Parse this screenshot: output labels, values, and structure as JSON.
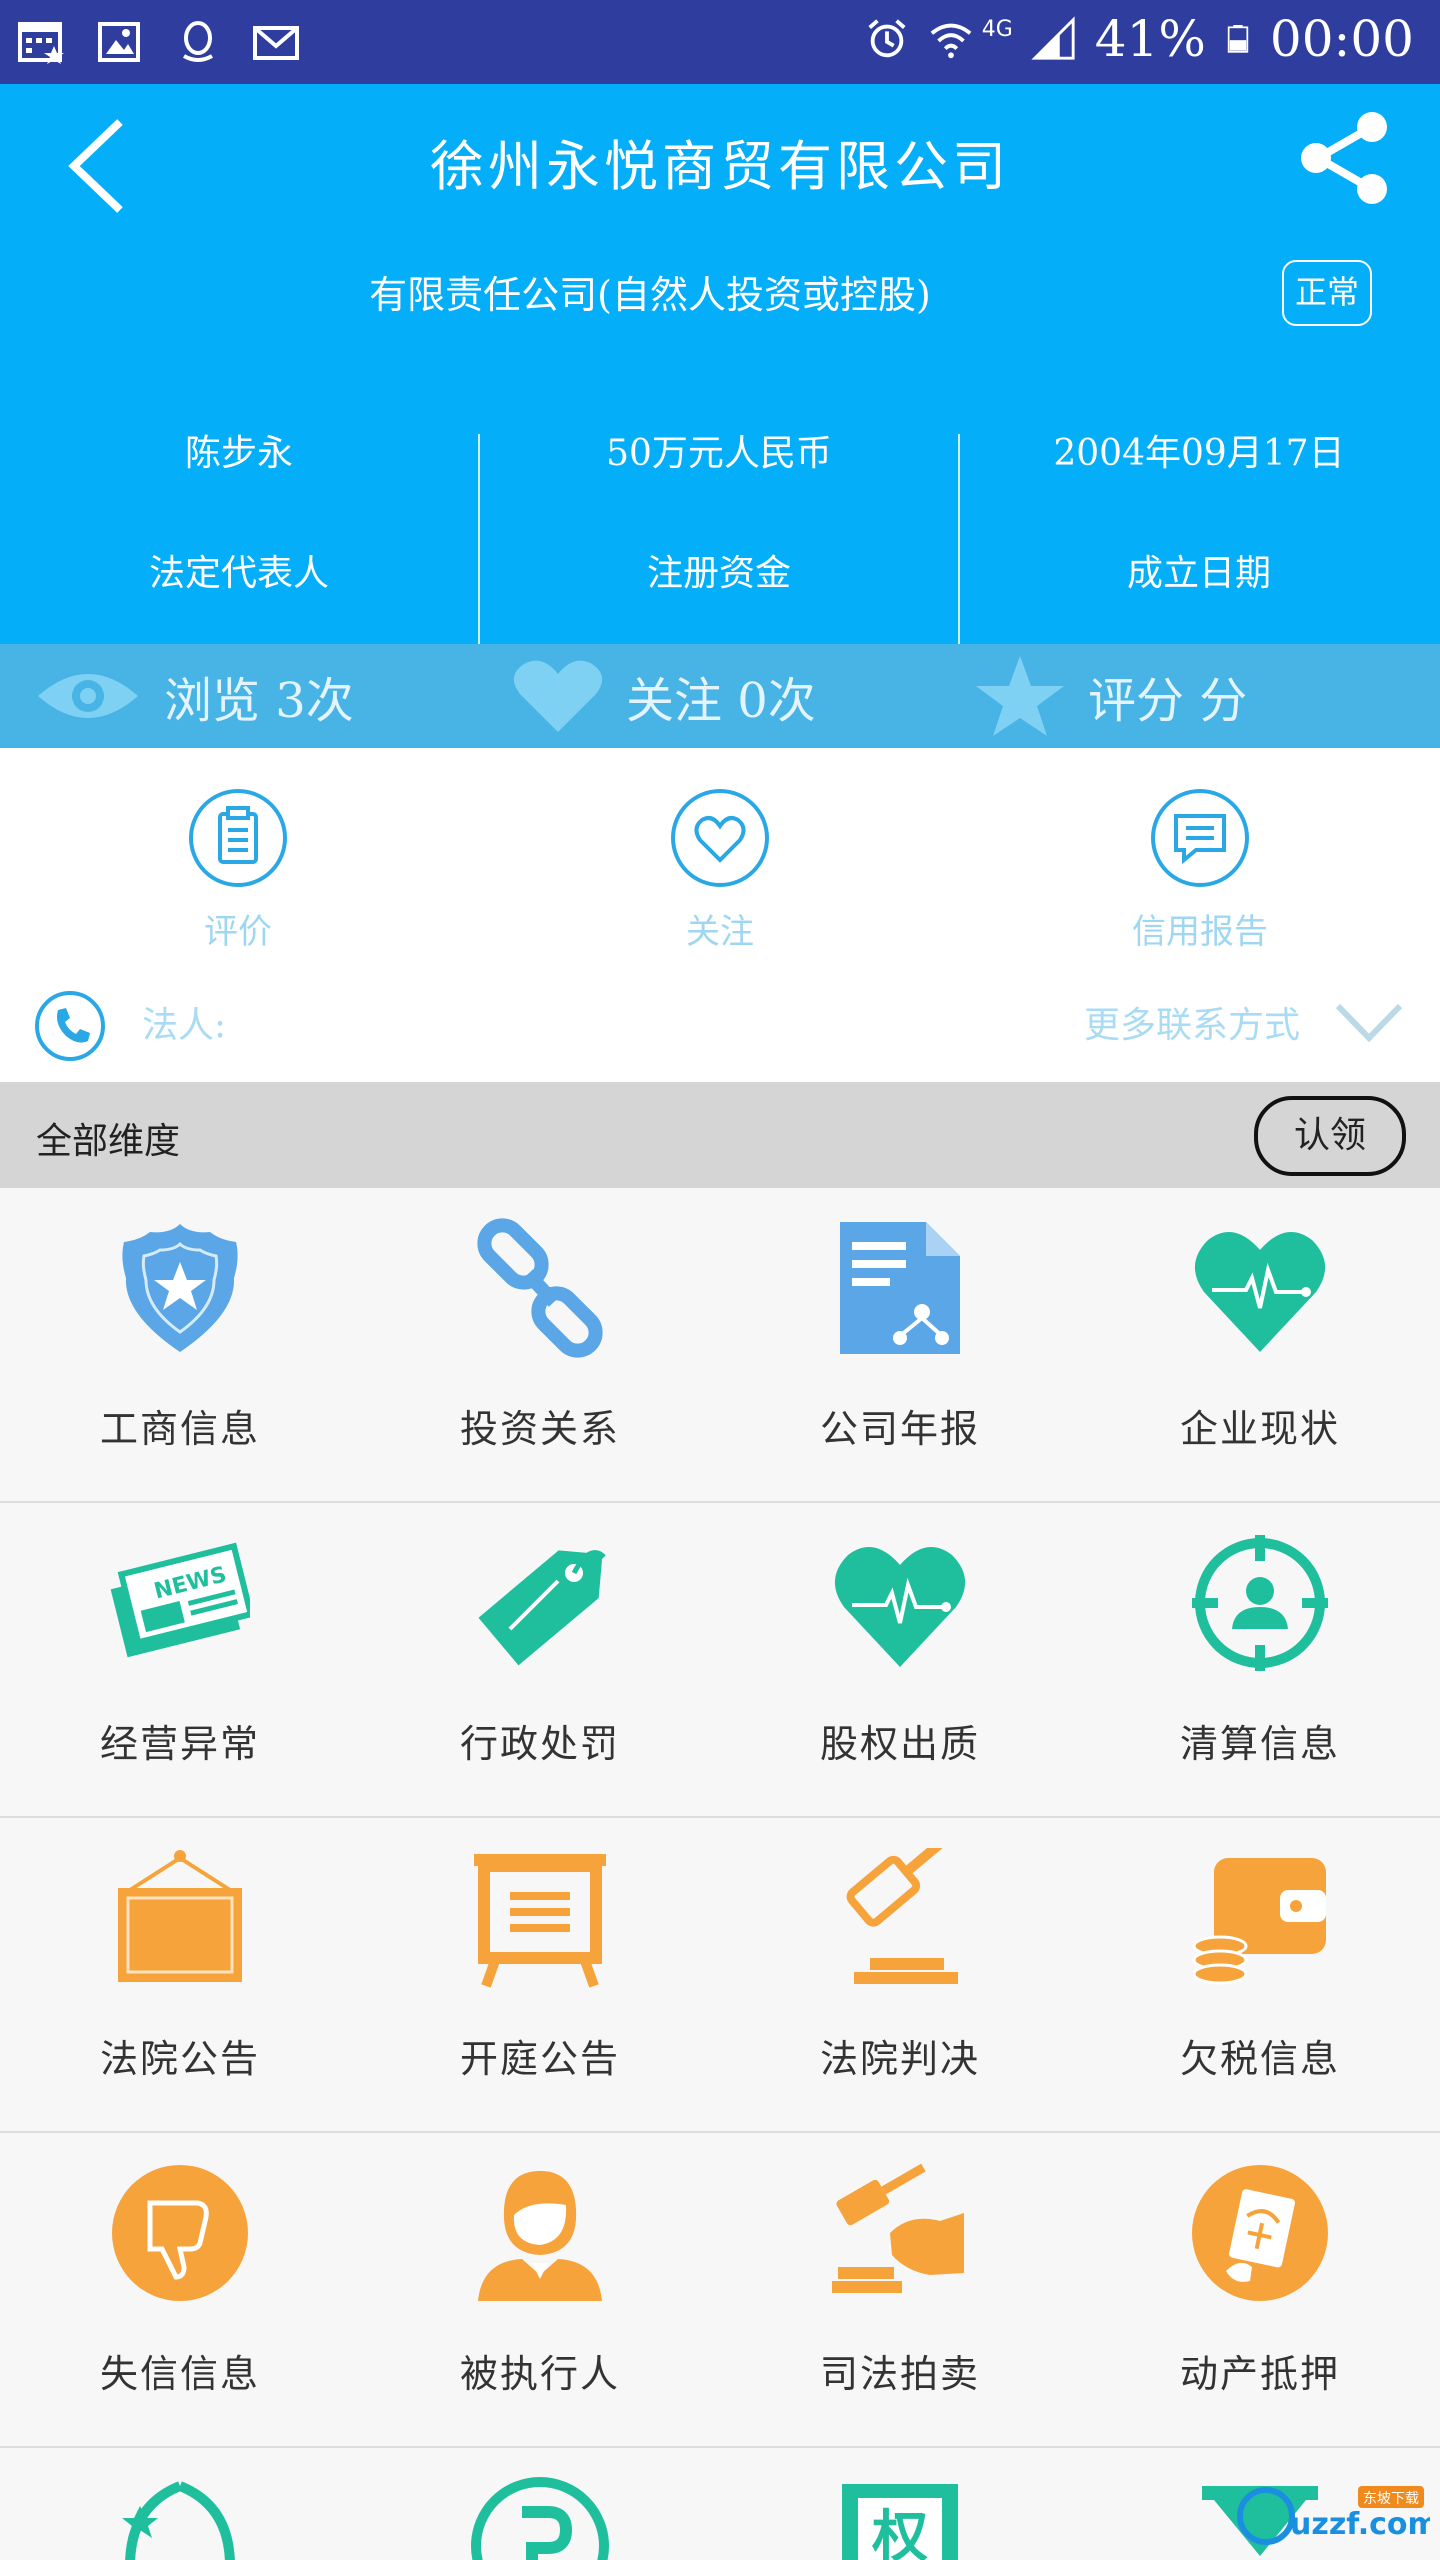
{
  "status_bar": {
    "battery": "41%",
    "time": "00:00",
    "network": "4G",
    "icons": [
      "calendar-icon",
      "image-icon",
      "qq-icon",
      "mail-icon",
      "alarm-icon",
      "wifi-icon",
      "signal-icon",
      "battery-icon"
    ]
  },
  "header": {
    "title": "徐州永悦商贸有限公司",
    "subtitle": "有限责任公司(自然人投资或控股)",
    "status_badge": "正常",
    "info": [
      {
        "value": "陈步永",
        "label": "法定代表人"
      },
      {
        "value": "50万元人民币",
        "label": "注册资金"
      },
      {
        "value": "2004年09月17日",
        "label": "成立日期"
      }
    ]
  },
  "stats": {
    "views": "浏览 3次",
    "follows": "关注 0次",
    "rating": "评分 分"
  },
  "actions": [
    {
      "label": "评价",
      "icon": "clipboard-icon"
    },
    {
      "label": "关注",
      "icon": "heart-icon"
    },
    {
      "label": "信用报告",
      "icon": "chat-report-icon"
    }
  ],
  "contact": {
    "legal_person_label": "法人:",
    "more_label": "更多联系方式"
  },
  "dimensions": {
    "title": "全部维度",
    "claim_button": "认领"
  },
  "grid": [
    [
      {
        "label": "工商信息",
        "icon": "police-badge-icon",
        "color": "#5aa6e6"
      },
      {
        "label": "投资关系",
        "icon": "chain-link-icon",
        "color": "#5aa6e6"
      },
      {
        "label": "公司年报",
        "icon": "report-document-icon",
        "color": "#5aa6e6"
      },
      {
        "label": "企业现状",
        "icon": "heart-pulse-icon",
        "color": "#1fbf9d"
      }
    ],
    [
      {
        "label": "经营异常",
        "icon": "newspaper-icon",
        "color": "#1fbf9d"
      },
      {
        "label": "行政处罚",
        "icon": "price-tag-icon",
        "color": "#1fbf9d"
      },
      {
        "label": "股权出质",
        "icon": "heart-pulse-icon",
        "color": "#1fbf9d"
      },
      {
        "label": "清算信息",
        "icon": "target-person-icon",
        "color": "#1fbf9d"
      }
    ],
    [
      {
        "label": "法院公告",
        "icon": "hanging-board-icon",
        "color": "#f5a33a"
      },
      {
        "label": "开庭公告",
        "icon": "easel-board-icon",
        "color": "#f5a33a"
      },
      {
        "label": "法院判决",
        "icon": "gavel-icon",
        "color": "#f5a33a"
      },
      {
        "label": "欠税信息",
        "icon": "wallet-coins-icon",
        "color": "#f5a33a"
      }
    ],
    [
      {
        "label": "失信信息",
        "icon": "thumbs-down-icon",
        "color": "#f5a33a"
      },
      {
        "label": "被执行人",
        "icon": "person-icon",
        "color": "#f5a33a"
      },
      {
        "label": "司法拍卖",
        "icon": "auction-gavel-icon",
        "color": "#f5a33a"
      },
      {
        "label": "动产抵押",
        "icon": "mortgage-document-icon",
        "color": "#f5a33a"
      }
    ]
  ],
  "partial_row": [
    {
      "icon": "trademark-icon",
      "color": "#1fbf9d",
      "text": ""
    },
    {
      "icon": "parking-p-icon",
      "color": "#1fbf9d",
      "text": ""
    },
    {
      "icon": "rights-document-icon",
      "color": "#1fbf9d",
      "text": "权"
    },
    {
      "icon": "hourglass-icon",
      "color": "#1fbf9d",
      "text": ""
    }
  ],
  "watermark": {
    "text": "uzzf.com",
    "badge": "东坡下载"
  }
}
